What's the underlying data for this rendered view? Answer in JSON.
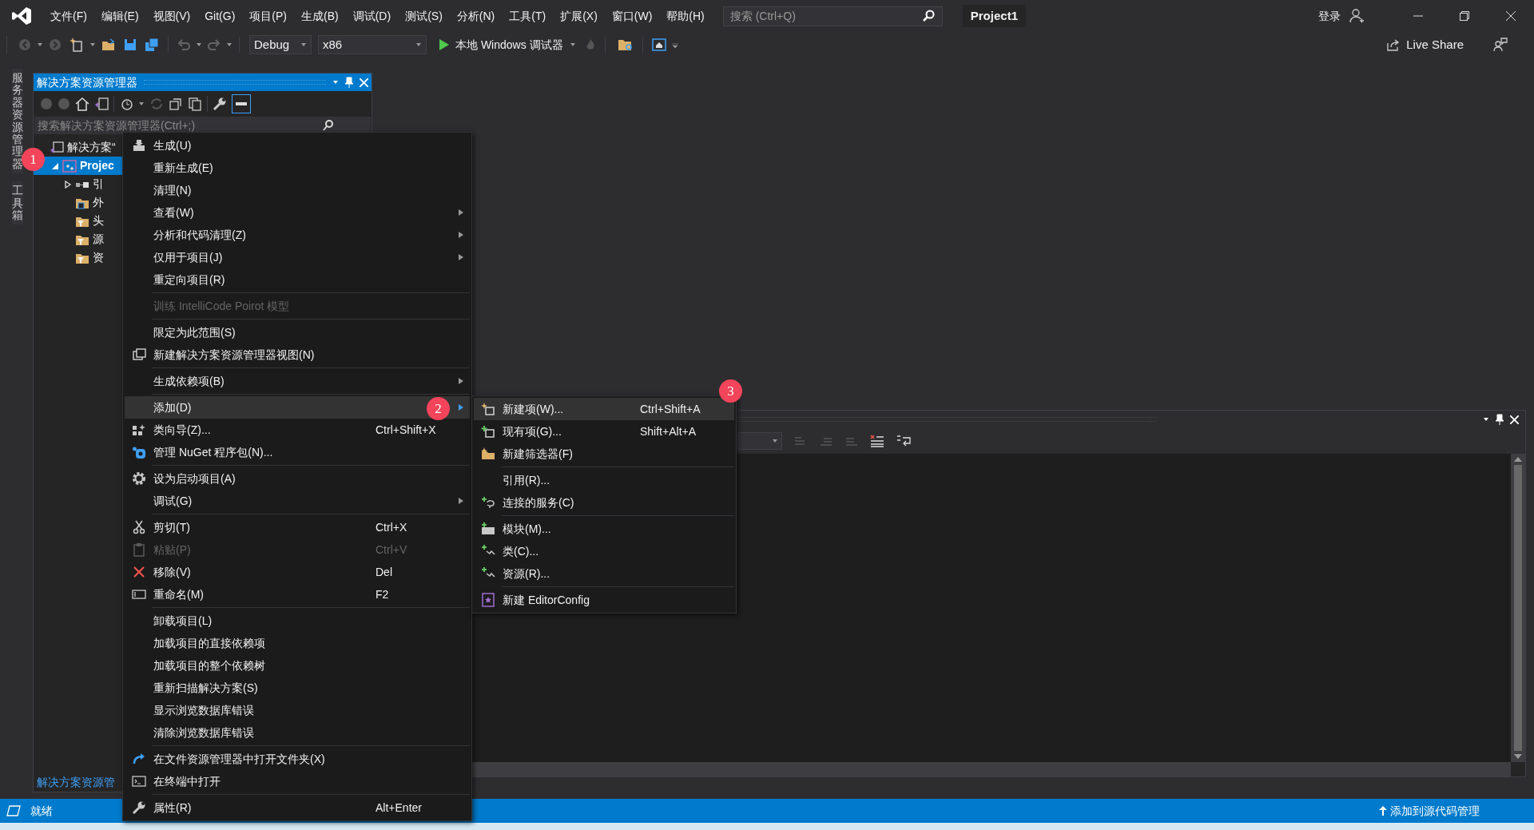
{
  "title_bar": {
    "menu": [
      "文件(F)",
      "编辑(E)",
      "视图(V)",
      "Git(G)",
      "项目(P)",
      "生成(B)",
      "调试(D)",
      "测试(S)",
      "分析(N)",
      "工具(T)",
      "扩展(X)",
      "窗口(W)",
      "帮助(H)"
    ],
    "search": {
      "placeholder": "搜索 (Ctrl+Q)"
    },
    "solution_name": "Project1",
    "sign_in": "登录"
  },
  "toolbar": {
    "configuration": "Debug",
    "platform": "x86",
    "run_label": "本地 Windows 调试器",
    "live_share": "Live Share"
  },
  "side_tabs": [
    "服务器资源管理器",
    "工具箱"
  ],
  "solution_explorer": {
    "title": "解决方案资源管理器",
    "search": {
      "placeholder": "搜索解决方案资源管理器(Ctrl+;)"
    },
    "tree": [
      {
        "label": "解决方案“",
        "selected": false,
        "children": [
          {
            "label": "Projec",
            "selected": true,
            "expanded": true,
            "children": [
              {
                "label": "引",
                "selected": false,
                "expanded": false
              },
              {
                "label": "外",
                "selected": false
              },
              {
                "label": "头",
                "selected": false
              },
              {
                "label": "源",
                "selected": false
              },
              {
                "label": "资",
                "selected": false
              }
            ]
          }
        ]
      }
    ],
    "bottom_tab": "解决方案资源管"
  },
  "context_menu": {
    "items": [
      {
        "kind": "item",
        "label": "生成(U)",
        "submenu": false,
        "disabled": false,
        "selected": false
      },
      {
        "kind": "item",
        "label": "重新生成(E)",
        "submenu": false,
        "disabled": false,
        "selected": false
      },
      {
        "kind": "item",
        "label": "清理(N)",
        "submenu": false,
        "disabled": false,
        "selected": false
      },
      {
        "kind": "item",
        "label": "查看(W)",
        "submenu": true,
        "disabled": false,
        "selected": false
      },
      {
        "kind": "item",
        "label": "分析和代码清理(Z)",
        "submenu": true,
        "disabled": false,
        "selected": false
      },
      {
        "kind": "item",
        "label": "仅用于项目(J)",
        "submenu": true,
        "disabled": false,
        "selected": false
      },
      {
        "kind": "item",
        "label": "重定向项目(R)",
        "submenu": false,
        "disabled": false,
        "selected": false
      },
      {
        "kind": "separator"
      },
      {
        "kind": "item",
        "label": "训练 IntelliCode Poirot 模型",
        "submenu": false,
        "disabled": true,
        "selected": false
      },
      {
        "kind": "separator"
      },
      {
        "kind": "item",
        "label": "限定为此范围(S)",
        "submenu": false,
        "disabled": false,
        "selected": false
      },
      {
        "kind": "item",
        "label": "新建解决方案资源管理器视图(N)",
        "submenu": false,
        "disabled": false,
        "selected": false
      },
      {
        "kind": "separator"
      },
      {
        "kind": "item",
        "label": "生成依赖项(B)",
        "submenu": true,
        "disabled": false,
        "selected": false
      },
      {
        "kind": "separator"
      },
      {
        "kind": "item",
        "label": "添加(D)",
        "submenu": true,
        "disabled": false,
        "selected": true
      },
      {
        "kind": "item",
        "label": "类向导(Z)...",
        "shortcut": "Ctrl+Shift+X",
        "submenu": false,
        "disabled": false,
        "selected": false
      },
      {
        "kind": "item",
        "label": "管理 NuGet 程序包(N)...",
        "submenu": false,
        "disabled": false,
        "selected": false
      },
      {
        "kind": "separator"
      },
      {
        "kind": "item",
        "label": "设为启动项目(A)",
        "submenu": false,
        "disabled": false,
        "selected": false
      },
      {
        "kind": "item",
        "label": "调试(G)",
        "submenu": true,
        "disabled": false,
        "selected": false
      },
      {
        "kind": "separator"
      },
      {
        "kind": "item",
        "label": "剪切(T)",
        "shortcut": "Ctrl+X",
        "submenu": false,
        "disabled": false,
        "selected": false
      },
      {
        "kind": "item",
        "label": "粘贴(P)",
        "shortcut": "Ctrl+V",
        "submenu": false,
        "disabled": true,
        "selected": false
      },
      {
        "kind": "item",
        "label": "移除(V)",
        "shortcut": "Del",
        "submenu": false,
        "disabled": false,
        "selected": false
      },
      {
        "kind": "item",
        "label": "重命名(M)",
        "shortcut": "F2",
        "submenu": false,
        "disabled": false,
        "selected": false
      },
      {
        "kind": "separator"
      },
      {
        "kind": "item",
        "label": "卸载项目(L)",
        "submenu": false,
        "disabled": false,
        "selected": false
      },
      {
        "kind": "item",
        "label": "加载项目的直接依赖项",
        "submenu": false,
        "disabled": false,
        "selected": false
      },
      {
        "kind": "item",
        "label": "加载项目的整个依赖树",
        "submenu": false,
        "disabled": false,
        "selected": false
      },
      {
        "kind": "item",
        "label": "重新扫描解决方案(S)",
        "submenu": false,
        "disabled": false,
        "selected": false
      },
      {
        "kind": "item",
        "label": "显示浏览数据库错误",
        "submenu": false,
        "disabled": false,
        "selected": false
      },
      {
        "kind": "item",
        "label": "清除浏览数据库错误",
        "submenu": false,
        "disabled": false,
        "selected": false
      },
      {
        "kind": "separator"
      },
      {
        "kind": "item",
        "label": "在文件资源管理器中打开文件夹(X)",
        "submenu": false,
        "disabled": false,
        "selected": false
      },
      {
        "kind": "item",
        "label": "在终端中打开",
        "submenu": false,
        "disabled": false,
        "selected": false
      },
      {
        "kind": "separator"
      },
      {
        "kind": "item",
        "label": "属性(R)",
        "shortcut": "Alt+Enter",
        "submenu": false,
        "disabled": false,
        "selected": false
      }
    ]
  },
  "submenu": {
    "items": [
      {
        "kind": "item",
        "label": "新建项(W)...",
        "shortcut": "Ctrl+Shift+A",
        "selected": true
      },
      {
        "kind": "item",
        "label": "现有项(G)...",
        "shortcut": "Shift+Alt+A",
        "selected": false
      },
      {
        "kind": "item",
        "label": "新建筛选器(F)",
        "selected": false
      },
      {
        "kind": "separator"
      },
      {
        "kind": "item",
        "label": "引用(R)...",
        "selected": false
      },
      {
        "kind": "item",
        "label": "连接的服务(C)",
        "selected": false
      },
      {
        "kind": "separator"
      },
      {
        "kind": "item",
        "label": "模块(M)...",
        "selected": false
      },
      {
        "kind": "item",
        "label": "类(C)...",
        "selected": false
      },
      {
        "kind": "item",
        "label": "资源(R)...",
        "selected": false
      },
      {
        "kind": "separator"
      },
      {
        "kind": "item",
        "label": "新建 EditorConfig",
        "selected": false
      }
    ]
  },
  "callouts": [
    "1",
    "2",
    "3"
  ],
  "status_bar": {
    "text": "就绪",
    "right_text": "添加到源代码管理"
  }
}
